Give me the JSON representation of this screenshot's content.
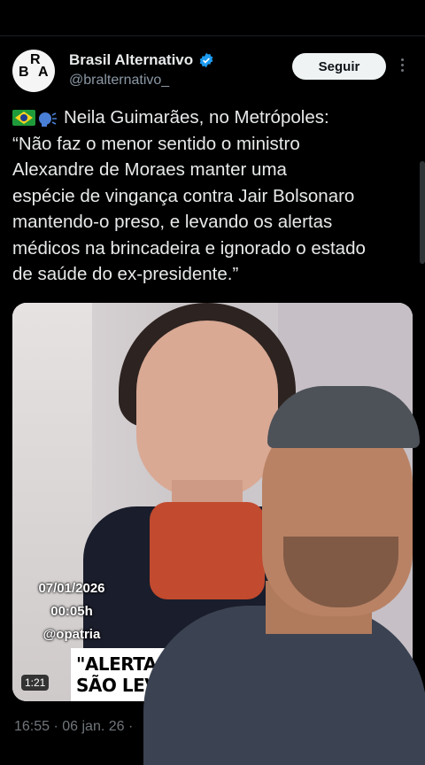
{
  "account": {
    "logo_letters": [
      "R",
      "B",
      "A"
    ],
    "name": "Brasil Alternativo",
    "handle": "@bralternativo_",
    "follow_label": "Seguir"
  },
  "tweet": {
    "emojis": [
      "brazil-flag-icon",
      "speaking-head-icon"
    ],
    "text": "Neila Guimarães, no Metrópoles:\n“Não faz o menor sentido o ministro\nAlexandre de Moraes manter uma\nespécie de vingança contra Jair Bolsonaro\nmantendo-o preso, e levando os alertas\nmédicos na brincadeira e ignorado o estado\nde saúde do ex-presidente.”"
  },
  "media": {
    "overlay_date": "07/01/2026",
    "overlay_time": "00:05h",
    "overlay_handle": "@opatria",
    "banner_text": "\"ALERTAS MÉ\nSÃO LEVADO",
    "duration": "1:21"
  },
  "meta": {
    "timestamp": "16:55 · 06 jan. 26 ·"
  },
  "colors": {
    "background": "#000000",
    "text": "#e7e9ea",
    "secondary_text": "#71767b",
    "verified": "#1d9bf0"
  }
}
